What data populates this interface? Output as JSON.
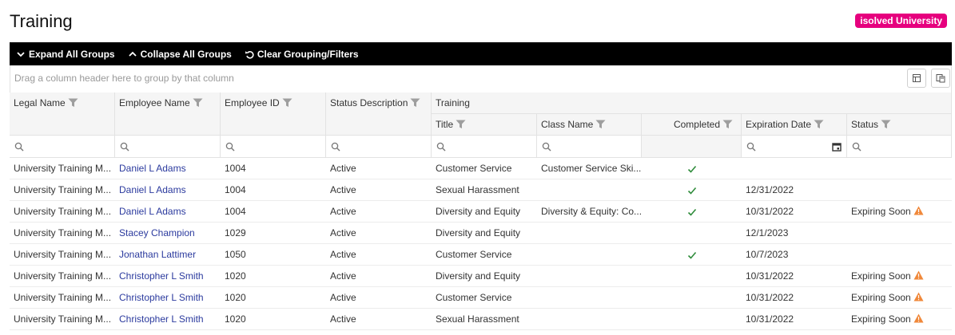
{
  "page": {
    "title": "Training",
    "brand_badge": "isolved University"
  },
  "toolbar": {
    "expand_all": "Expand All Groups",
    "collapse_all": "Collapse All Groups",
    "clear": "Clear Grouping/Filters"
  },
  "group_panel": {
    "hint": "Drag a column header here to group by that column"
  },
  "grid": {
    "group_header": "Training",
    "columns": {
      "legal_name": "Legal Name",
      "employee_name": "Employee Name",
      "employee_id": "Employee ID",
      "status_description": "Status Description",
      "title": "Title",
      "class_name": "Class Name",
      "completed": "Completed",
      "expiration_date": "Expiration Date",
      "status": "Status"
    },
    "rows": [
      {
        "legal_name": "University Training M...",
        "employee_name": "Daniel L Adams",
        "employee_id": "1004",
        "status_description": "Active",
        "title": "Customer Service",
        "class_name": "Customer Service Ski...",
        "completed": true,
        "expiration_date": "",
        "status": "",
        "warning": false
      },
      {
        "legal_name": "University Training M...",
        "employee_name": "Daniel L Adams",
        "employee_id": "1004",
        "status_description": "Active",
        "title": "Sexual Harassment",
        "class_name": "",
        "completed": true,
        "expiration_date": "12/31/2022",
        "status": "",
        "warning": false
      },
      {
        "legal_name": "University Training M...",
        "employee_name": "Daniel L Adams",
        "employee_id": "1004",
        "status_description": "Active",
        "title": "Diversity and Equity",
        "class_name": "Diversity & Equity: Co...",
        "completed": true,
        "expiration_date": "10/31/2022",
        "status": "Expiring Soon",
        "warning": true
      },
      {
        "legal_name": "University Training M...",
        "employee_name": "Stacey Champion",
        "employee_id": "1029",
        "status_description": "Active",
        "title": "Diversity and Equity",
        "class_name": "",
        "completed": false,
        "expiration_date": "12/1/2023",
        "status": "",
        "warning": false
      },
      {
        "legal_name": "University Training M...",
        "employee_name": "Jonathan Lattimer",
        "employee_id": "1050",
        "status_description": "Active",
        "title": "Customer Service",
        "class_name": "",
        "completed": true,
        "expiration_date": "10/7/2023",
        "status": "",
        "warning": false
      },
      {
        "legal_name": "University Training M...",
        "employee_name": "Christopher L Smith",
        "employee_id": "1020",
        "status_description": "Active",
        "title": "Diversity and Equity",
        "class_name": "",
        "completed": false,
        "expiration_date": "10/31/2022",
        "status": "Expiring Soon",
        "warning": true
      },
      {
        "legal_name": "University Training M...",
        "employee_name": "Christopher L Smith",
        "employee_id": "1020",
        "status_description": "Active",
        "title": "Customer Service",
        "class_name": "",
        "completed": false,
        "expiration_date": "10/31/2022",
        "status": "Expiring Soon",
        "warning": true
      },
      {
        "legal_name": "University Training M...",
        "employee_name": "Christopher L Smith",
        "employee_id": "1020",
        "status_description": "Active",
        "title": "Sexual Harassment",
        "class_name": "",
        "completed": false,
        "expiration_date": "10/31/2022",
        "status": "Expiring Soon",
        "warning": true
      }
    ]
  },
  "icons": {
    "expand": "chevron-down-icon",
    "collapse": "chevron-up-icon",
    "clear": "undo-icon",
    "filter": "funnel-icon",
    "search": "search-icon",
    "calendar": "calendar-icon",
    "check": "check-icon",
    "warning": "warning-icon"
  },
  "colors": {
    "brand": "#e6007e",
    "toolbar": "#000000",
    "link": "#2b3a9e",
    "check": "#2e8b3a",
    "warning": "#f0883a"
  }
}
